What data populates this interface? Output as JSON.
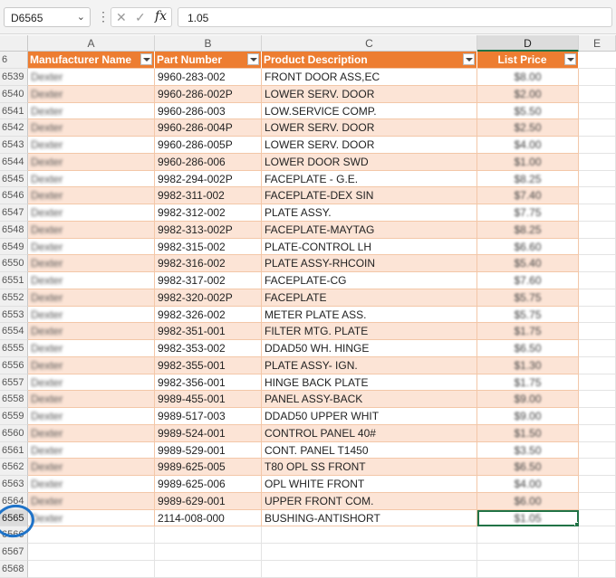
{
  "formula_bar": {
    "name_box": "D6565",
    "formula_value": "1.05",
    "cancel_icon": "close-icon",
    "enter_icon": "check-icon",
    "fx_label": "fx"
  },
  "columns": [
    "A",
    "B",
    "C",
    "D",
    "E"
  ],
  "header_row": {
    "row_number": "6",
    "manufacturer": "Manufacturer Name",
    "part_number": "Part Number",
    "description": "Product Description",
    "list_price": "List Price"
  },
  "rows": [
    {
      "num": "6539",
      "mfr": "Dexter",
      "part": "9960-283-002",
      "desc": "FRONT DOOR ASS,EC",
      "price": "$8.00"
    },
    {
      "num": "6540",
      "mfr": "Dexter",
      "part": "9960-286-002P",
      "desc": "LOWER SERV. DOOR",
      "price": "$2.00"
    },
    {
      "num": "6541",
      "mfr": "Dexter",
      "part": "9960-286-003",
      "desc": "LOW.SERVICE COMP.",
      "price": "$5.50"
    },
    {
      "num": "6542",
      "mfr": "Dexter",
      "part": "9960-286-004P",
      "desc": "LOWER SERV. DOOR",
      "price": "$2.50"
    },
    {
      "num": "6543",
      "mfr": "Dexter",
      "part": "9960-286-005P",
      "desc": "LOWER SERV. DOOR",
      "price": "$4.00"
    },
    {
      "num": "6544",
      "mfr": "Dexter",
      "part": "9960-286-006",
      "desc": "LOWER DOOR SWD",
      "price": "$1.00"
    },
    {
      "num": "6545",
      "mfr": "Dexter",
      "part": "9982-294-002P",
      "desc": "FACEPLATE - G.E.",
      "price": "$8.25"
    },
    {
      "num": "6546",
      "mfr": "Dexter",
      "part": "9982-311-002",
      "desc": "FACEPLATE-DEX SIN",
      "price": "$7.40"
    },
    {
      "num": "6547",
      "mfr": "Dexter",
      "part": "9982-312-002",
      "desc": "PLATE ASSY.",
      "price": "$7.75"
    },
    {
      "num": "6548",
      "mfr": "Dexter",
      "part": "9982-313-002P",
      "desc": "FACEPLATE-MAYTAG",
      "price": "$8.25"
    },
    {
      "num": "6549",
      "mfr": "Dexter",
      "part": "9982-315-002",
      "desc": "PLATE-CONTROL LH",
      "price": "$6.60"
    },
    {
      "num": "6550",
      "mfr": "Dexter",
      "part": "9982-316-002",
      "desc": "PLATE ASSY-RHCOIN",
      "price": "$5.40"
    },
    {
      "num": "6551",
      "mfr": "Dexter",
      "part": "9982-317-002",
      "desc": "FACEPLATE-CG",
      "price": "$7.60"
    },
    {
      "num": "6552",
      "mfr": "Dexter",
      "part": "9982-320-002P",
      "desc": "FACEPLATE",
      "price": "$5.75"
    },
    {
      "num": "6553",
      "mfr": "Dexter",
      "part": "9982-326-002",
      "desc": "METER PLATE ASS.",
      "price": "$5.75"
    },
    {
      "num": "6554",
      "mfr": "Dexter",
      "part": "9982-351-001",
      "desc": "FILTER MTG. PLATE",
      "price": "$1.75"
    },
    {
      "num": "6555",
      "mfr": "Dexter",
      "part": "9982-353-002",
      "desc": "DDAD50 WH. HINGE",
      "price": "$6.50"
    },
    {
      "num": "6556",
      "mfr": "Dexter",
      "part": "9982-355-001",
      "desc": "PLATE ASSY- IGN.",
      "price": "$1.30"
    },
    {
      "num": "6557",
      "mfr": "Dexter",
      "part": "9982-356-001",
      "desc": "HINGE BACK PLATE",
      "price": "$1.75"
    },
    {
      "num": "6558",
      "mfr": "Dexter",
      "part": "9989-455-001",
      "desc": "PANEL ASSY-BACK",
      "price": "$9.00"
    },
    {
      "num": "6559",
      "mfr": "Dexter",
      "part": "9989-517-003",
      "desc": "DDAD50 UPPER WHIT",
      "price": "$9.00"
    },
    {
      "num": "6560",
      "mfr": "Dexter",
      "part": "9989-524-001",
      "desc": "CONTROL PANEL 40#",
      "price": "$1.50"
    },
    {
      "num": "6561",
      "mfr": "Dexter",
      "part": "9989-529-001",
      "desc": "CONT. PANEL T1450",
      "price": "$3.50"
    },
    {
      "num": "6562",
      "mfr": "Dexter",
      "part": "9989-625-005",
      "desc": "T80 OPL SS FRONT",
      "price": "$6.50"
    },
    {
      "num": "6563",
      "mfr": "Dexter",
      "part": "9989-625-006",
      "desc": "OPL WHITE FRONT",
      "price": "$4.00"
    },
    {
      "num": "6564",
      "mfr": "Dexter",
      "part": "9989-629-001",
      "desc": "UPPER FRONT COM.",
      "price": "$6.00"
    },
    {
      "num": "6565",
      "mfr": "Dexter",
      "part": "2114-008-000",
      "desc": "BUSHING-ANTISHORT",
      "price": "$1.05"
    }
  ],
  "empty_rows": [
    "6566",
    "6567",
    "6568"
  ],
  "colors": {
    "header_orange": "#ed7d31",
    "band_peach": "#fce4d6",
    "selection_green": "#217346",
    "annotation_blue": "#1f73c8"
  }
}
